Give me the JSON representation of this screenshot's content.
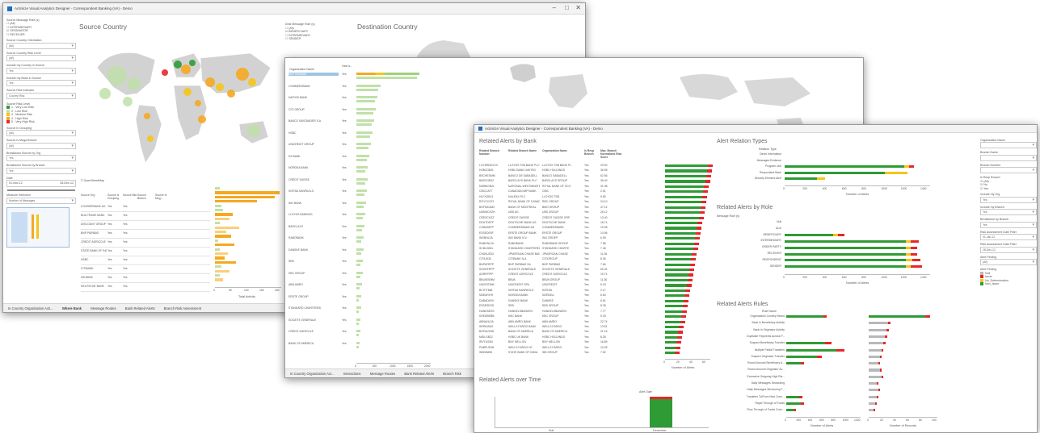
{
  "colors": {
    "green": "#2e9b35",
    "red": "#e8262a",
    "yellow": "#f5c518",
    "orange": "#f4a922",
    "light_green": "#bfe0a8",
    "grey": "#b8b8b8"
  },
  "win1": {
    "title": "Actimize Visual Analytics Designer - Correspondent Banking (VA) - Demo",
    "filter_title": "Source Message Role (s)",
    "roles": [
      "(All)",
      "INTERMEDIARY",
      "ORIGINATOR",
      "RECEIVER"
    ],
    "filters": [
      {
        "label": "Source Country Orientation",
        "value": "(All)"
      },
      {
        "label": "Source Country Risk Level",
        "value": "(All)"
      },
      {
        "label": "Include my Country in Source",
        "value": "Yes"
      },
      {
        "label": "Include my Bank in Source",
        "value": "Yes"
      },
      {
        "label": "Source Risk Indicator",
        "value": "Country Risk"
      }
    ],
    "risk_legend_title": "Source Risk Level",
    "risk_legend": [
      "1 - Very Low Risk",
      "2 - Low Risk",
      "3 - Medium Risk",
      "4 - High Risk",
      "5 - Very High Risk"
    ],
    "filters2": [
      {
        "label": "Source In Grouping",
        "value": "(All)"
      },
      {
        "label": "Source Is Mega Branch",
        "value": "(All)"
      },
      {
        "label": "Breakdown Source by Org",
        "value": "Yes"
      },
      {
        "label": "Breakdown Source by Branch",
        "value": "Yes"
      }
    ],
    "date_label": "Date",
    "date_from": "01-Nov-12",
    "date_to": "28-Dec-12",
    "measure_label": "Measure Selection",
    "measure_value": "Number of Messages",
    "source_title": "Source Country",
    "dest_role_title": "Dest Message Role (s)",
    "dest_roles": [
      "(All)",
      "BENEFICIARY",
      "INTERMEDIARY",
      "SENDER"
    ],
    "dest_title": "Destination Country",
    "copyright": "© OpenStreetMap",
    "table_headers": [
      "Source Org",
      "Source Is Grouping",
      "Source Mkt",
      "Source Branch",
      "Source Is Meg..."
    ],
    "table_rows": [
      "COURIERBANK AG",
      "BOA TRADE BANK",
      "DISCOUNT GROUP",
      "BNP PARIBAS",
      "CREDIT AGRICOLE",
      "STATE BANK OF INDIA",
      "HSBC",
      "CITIBANK",
      "DB BANK",
      "DEUTSCHE BANK"
    ],
    "axis_title": "Total Activity",
    "axis_ticks": [
      "0",
      "50",
      "100",
      "150",
      "200"
    ],
    "tabs": [
      "In Country Organization Acti...",
      "Where Bank",
      "Message Routes",
      "Bank Related Alerts",
      "Branch Risk Assessment"
    ]
  },
  "win2": {
    "col_org": "Organization Name",
    "col_iss": "Has Is...",
    "orgs": [
      "BNP PARIBAS",
      "COMMERZBANK",
      "NATIXIS BANK",
      "CITI GROUP",
      "BANCO SANTANDER S.A.",
      "HSBC",
      "UNICREDIT GROUP",
      "DZ BANK",
      "NORDEA BANK",
      "CREDIT SUISSE",
      "INTESA SANPAOLO",
      "ING BANK",
      "LLOYDS BANKING",
      "BARCLAYS",
      "RABOBANK",
      "DANSKE BANK",
      "SEB",
      "KBC GROUP",
      "ABN AMRO",
      "ERSTE GROUP",
      "STANDARD CHARTERED",
      "SOCIETE GENERALE",
      "CREDIT AGRICOLE",
      "BANK OF AMERICA"
    ],
    "yes": "Yes",
    "axis_title": "Country_Total",
    "axis_ticks": [
      "0",
      "500",
      "1000",
      "1500",
      "2000"
    ],
    "right_filters": [
      {
        "label": "Month",
        "value": "(All)"
      },
      {
        "label": "Measure Selection",
        "value": "Number of Messages"
      },
      {
        "label": "Organization Name",
        "value": ""
      },
      {
        "label": "Respondent Org",
        "value": "(All)"
      }
    ],
    "right_last": "Include My Country",
    "tabs": [
      "In Country Organization Act...",
      "Interactions",
      "Message Routes",
      "Bank Related Alerts",
      "Branch Risk"
    ]
  },
  "win3": {
    "title": "Actimize Visual Analytics Designer - Correspondent Banking (VA) - Demo",
    "bank_title": "Related Alerts by Bank",
    "bank_headers": [
      "Related Branch Number",
      "Related Branch Name",
      "Organization Name",
      "Is Resp Branch",
      "Max. Branch Normalized Risk Score"
    ],
    "bank_rows": [
      [
        "LOYDBDEXXX",
        "LLOYDS TSB BANK PLC",
        "LLOYDS TSB BANK PL",
        "Yes",
        "29.90"
      ],
      [
        "HSBCGB2L",
        "HSBC BANK LIMITED",
        "HSBC HOLDINGS",
        "Yes",
        "36.95"
      ],
      [
        "BSCHESMM",
        "BANCO DE SABADELL",
        "BANCO SABADELL",
        "Yes",
        "62.56"
      ],
      [
        "BARCGB22",
        "BARCLAYS BANK PLC",
        "BARCLAYS GROUP",
        "Yes",
        "36.40"
      ],
      [
        "NWBKGB2L",
        "NATIONAL WESTMINSTER",
        "ROYAL BANK OF SCO",
        "Yes",
        "31.98"
      ],
      [
        "CIBCCATT",
        "CANADIAN IMP BANK",
        "CIBC",
        "Yes",
        "2.51"
      ],
      [
        "HLFXGB21",
        "HALIFAX PLC",
        "LLOYDS TSB",
        "Yes",
        "9.80"
      ],
      [
        "ROYCCAT2",
        "ROYAL BANK OF CANADA",
        "RBC GROUP",
        "Yes",
        "24.10"
      ],
      [
        "BOFMCAM2",
        "BANK OF MONTREAL",
        "BMO GROUP",
        "Yes",
        "47.12"
      ],
      [
        "UBSWCHZH",
        "UBS AG",
        "UBS GROUP",
        "Yes",
        "26.12"
      ],
      [
        "CRESCHZZ",
        "CREDIT SUISSE",
        "CREDIT SUISSE GRP",
        "Yes",
        "13.40"
      ],
      [
        "DEUTDEFF",
        "DEUTSCHE BANK AG",
        "DEUTSCHE BANK",
        "Yes",
        "18.74"
      ],
      [
        "COBADEFF",
        "COMMERZBANK AG",
        "COMMERZBANK",
        "Yes",
        "19.08"
      ],
      [
        "ESSEDE5F",
        "ERSTE GROUP BANK",
        "ERSTE GROUP",
        "Yes",
        "14.96"
      ],
      [
        "INGBNL2A",
        "ING BANK N.V.",
        "ING GROEP",
        "Yes",
        "6.95"
      ],
      [
        "RABONL2U",
        "RABOBANK",
        "RABOBANK GROUP",
        "Yes",
        "7.88"
      ],
      [
        "SCBLGB2L",
        "STANDARD CHARTERED",
        "STANDARD CHARTE",
        "Yes",
        "7.46"
      ],
      [
        "CHASUS33",
        "JPMORGAN CHASE BANK",
        "JPMORGAN CHASE",
        "Yes",
        "11.06"
      ],
      [
        "CITIUS33",
        "CITIBANK N.A.",
        "CITIGROUP",
        "Yes",
        "8.05"
      ],
      [
        "BNPAFRPP",
        "BNP PARIBAS SA",
        "BNP PARIBAS",
        "Yes",
        "7.84"
      ],
      [
        "SOGEFRPP",
        "SOCIETE GENERALE",
        "SOCIETE GENERALE",
        "Yes",
        "60.31"
      ],
      [
        "AGRIFRPP",
        "CREDIT AGRICOLE",
        "CREDIT AGRICOLE",
        "Yes",
        "19.74"
      ],
      [
        "BBVAESMM",
        "BBVA",
        "BBVA GROUP",
        "Yes",
        "11.36"
      ],
      [
        "UNCRITMM",
        "UNICREDIT SPA",
        "UNICREDIT",
        "Yes",
        "6.03"
      ],
      [
        "BCITITMM",
        "INTESA SANPAOLO",
        "INTESA",
        "Yes",
        "2.17"
      ],
      [
        "NDEAFIHH",
        "NORDEA BANK",
        "NORDEA",
        "Yes",
        "6.60"
      ],
      [
        "DABADKKK",
        "DANSKE BANK",
        "DANSKE",
        "Yes",
        "6.61"
      ],
      [
        "ESSESESS",
        "SEB",
        "SEB GROUP",
        "Yes",
        "8.35"
      ],
      [
        "HANDSESS",
        "HANDELSBANKEN",
        "HANDELSBANKEN",
        "Yes",
        "7.77"
      ],
      [
        "KREDBEBB",
        "KBC BANK",
        "KBC GROUP",
        "Yes",
        "9.03"
      ],
      [
        "ABNANL2A",
        "ABN AMRO BANK",
        "ABN AMRO",
        "Yes",
        "22.74"
      ],
      [
        "WFBIUS6S",
        "WELLS FARGO BANK",
        "WELLS FARGO",
        "Yes",
        "13.51"
      ],
      [
        "BOFAUS3N",
        "BANK OF AMERICA",
        "BANK OF AMERICA",
        "Yes",
        "21.16"
      ],
      [
        "MIDLGB22",
        "HSBC UK BANK",
        "HSBC HOLDINGS",
        "Yes",
        "8.28"
      ],
      [
        "IRVTUS3N",
        "BNY MELLON",
        "BNY MELLON",
        "Yes",
        "16.89"
      ],
      [
        "PNBPUS3N",
        "WELLS FARGO NY",
        "WELLS FARGO",
        "Yes",
        "10.25"
      ],
      [
        "SBININBB",
        "STATE BANK OF INDIA",
        "SBI GROUP",
        "Yes",
        "7.52"
      ]
    ],
    "bank_axis_title": "Number of Alerts",
    "bank_axis_ticks": [
      "0",
      "20",
      "40",
      "60"
    ],
    "rel_title": "Alert Relation Types",
    "rel_col": "Relation Type",
    "rel_rows": [
      "Direct Information",
      "Messages Evidence",
      "Program Unit",
      "Respondent Bank",
      "Security Element Alert"
    ],
    "rel_ticks": [
      "0",
      "200",
      "400",
      "600",
      "800",
      "1000",
      "1200",
      "1400"
    ],
    "role_title": "Related Alerts by Role",
    "role_col": "Message Role (s)",
    "role_rows": [
      "Null",
      "AUX",
      "BENEFICIARY",
      "INTERMEDIARY",
      "ORDER PARTY",
      "RECEIVER",
      "RESPONDENT",
      "SENDER"
    ],
    "role_ticks": [
      "0",
      "200",
      "400",
      "600",
      "800",
      "1000",
      "1200",
      "1400"
    ],
    "rules_title": "Related Alerts Rules",
    "rules_col": "Rule Name",
    "rules_rows": [
      "Organization Country Nexus",
      "Bank in Beneficiary Activity",
      "Bank in Originator Activity",
      "Duplicate Payments Across P...",
      "Suspect Beneficiary Transfer",
      "Multiple Partial Transfers",
      "Suspect Originator Transfer",
      "Round Amount Beneficiary A...",
      "Round Amount Originator Ac...",
      "Excessive Outgoing High Ris...",
      "Daily Messages Structuring",
      "Daily Messages Structuring T...",
      "Transfers To/From New Coun...",
      "Rapid Through of Funds",
      "Flow Through of Funds Coun..."
    ],
    "rules_ticks": [
      "0",
      "200",
      "400",
      "600",
      "800",
      "1000",
      "1200"
    ],
    "records_ticks": [
      "0",
      "20",
      "40",
      "60",
      "80",
      "100"
    ],
    "records_title": "Number of Records",
    "time_title": "Related Alerts over Time",
    "time_col": "Alert Date",
    "time_labels": [
      "Null",
      "December"
    ],
    "right_filters": [
      {
        "label": "Organization Name",
        "value": ""
      },
      {
        "label": "Branch Name",
        "value": ""
      },
      {
        "label": "Branch Number",
        "value": ""
      }
    ],
    "is_resp_label": "Is Resp Branch",
    "is_resp_options": [
      "(All)",
      "No",
      "Yes"
    ],
    "right_filters2": [
      {
        "label": "Include my Org",
        "value": "Yes"
      },
      {
        "label": "Include my Branch",
        "value": "Yes"
      },
      {
        "label": "Breakdown by Branch",
        "value": "Yes"
      },
      {
        "label": "Risk Assessment Date Filter",
        "value": "01-Jan-12"
      },
      {
        "label": "Risk Assessment Date Filter",
        "value": "28-Dec-12"
      },
      {
        "label": "Alert Finding",
        "value": "(All)"
      }
    ],
    "finding_legend_title": "Alert Finding",
    "finding_legend": [
      "Null",
      "Issue",
      "No_Determination",
      "Non_Issue"
    ],
    "tabs": [
      "In Country Organization Act...",
      "Interactions",
      "Message Routes",
      "Bank Related Alerts",
      "Branch Risk Assessment"
    ]
  }
}
